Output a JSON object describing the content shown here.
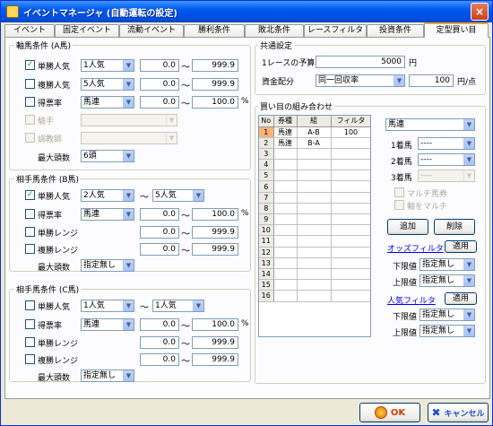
{
  "window": {
    "title": "イベントマネージャ (自動運転の設定)",
    "close": "×"
  },
  "tabs": [
    "イベント",
    "固定イベント",
    "流動イベント",
    "勝利条件",
    "敗北条件",
    "レースフィルタ",
    "投資条件",
    "定型買い目"
  ],
  "groupA": {
    "label": "軸馬条件 (A馬)",
    "rows": [
      {
        "label": "単勝人気",
        "checked": "✓",
        "combo": "1人気",
        "min": "0.0",
        "max": "999.9",
        "unit": ""
      },
      {
        "label": "複勝人気",
        "checked": "",
        "combo": "5人気",
        "min": "0.0",
        "max": "999.9",
        "unit": ""
      },
      {
        "label": "得票率",
        "checked": "",
        "combo": "馬連",
        "min": "0.0",
        "max": "100.0",
        "unit": "%"
      }
    ],
    "jockey": "騎手",
    "trainer": "調教師",
    "max_label": "最大頭数",
    "max_value": "6頭"
  },
  "groupB": {
    "label": "相手馬条件 (B馬)",
    "pop_label": "単勝人気",
    "pop_from": "2人気",
    "pop_to": "5人気",
    "vote_label": "得票率",
    "vote_combo": "馬連",
    "vote_min": "0.0",
    "vote_max": "100.0",
    "win_range": "単勝レンジ",
    "win_min": "0.0",
    "win_max": "999.9",
    "place_range": "複勝レンジ",
    "place_min": "0.0",
    "place_max": "999.9",
    "max_label": "最大頭数",
    "max_value": "指定無し"
  },
  "groupC": {
    "label": "相手馬条件 (C馬)",
    "pop_label": "単勝人気",
    "pop_from": "1人気",
    "pop_to": "1人気",
    "vote_label": "得票率",
    "vote_combo": "馬連",
    "vote_min": "0.0",
    "vote_max": "100.0",
    "win_range": "単勝レンジ",
    "win_min": "0.0",
    "win_max": "999.9",
    "place_range": "複勝レンジ",
    "place_min": "0.0",
    "place_max": "999.9",
    "max_label": "最大頭数",
    "max_value": "指定無し"
  },
  "common": {
    "label": "共通設定",
    "budget_label": "1レースの予算",
    "budget": "5000",
    "budget_unit": "円",
    "alloc_label": "資金配分",
    "alloc": "同一回収率",
    "alloc_amount": "100",
    "alloc_unit": "円/点"
  },
  "combo": {
    "label": "買い目の組み合わせ",
    "headers": [
      "No",
      "券種",
      "組",
      "フィルタ"
    ],
    "rows": [
      [
        "1",
        "馬連",
        "A-B",
        "100"
      ],
      [
        "2",
        "馬連",
        "B-A",
        ""
      ],
      [
        "3",
        "",
        "",
        ""
      ],
      [
        "4",
        "",
        "",
        ""
      ],
      [
        "5",
        "",
        "",
        ""
      ],
      [
        "6",
        "",
        "",
        ""
      ],
      [
        "7",
        "",
        "",
        ""
      ],
      [
        "8",
        "",
        "",
        ""
      ],
      [
        "9",
        "",
        "",
        ""
      ],
      [
        "10",
        "",
        "",
        ""
      ],
      [
        "11",
        "",
        "",
        ""
      ],
      [
        "12",
        "",
        "",
        ""
      ],
      [
        "13",
        "",
        "",
        ""
      ],
      [
        "14",
        "",
        "",
        ""
      ],
      [
        "15",
        "",
        "",
        ""
      ],
      [
        "16",
        "",
        "",
        ""
      ]
    ],
    "type": "馬連",
    "h1_label": "1着馬",
    "h1": "----",
    "h2_label": "2着馬",
    "h2": "----",
    "h3_label": "3着馬",
    "h3": "----",
    "multi": "マルチ馬券",
    "axis_multi": "軸をマルチ",
    "add": "追加",
    "delete": "削除",
    "odds_filter": "オッズフィルタ",
    "apply": "適用",
    "lower": "下限値",
    "upper": "上限値",
    "unset": "指定無し",
    "pop_filter": "人気フィルタ"
  },
  "footer": {
    "ok": "OK",
    "cancel": "キャンセル"
  }
}
